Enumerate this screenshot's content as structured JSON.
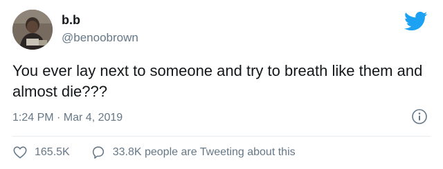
{
  "user": {
    "display_name": "b.b",
    "handle": "@benoobrown"
  },
  "tweet": {
    "text": "You ever lay next to someone and try to breath like them and almost die???",
    "timestamp": "1:24 PM · Mar 4, 2019"
  },
  "stats": {
    "likes": "165.5K",
    "retweet_discussion": "33.8K people are Tweeting about this"
  },
  "icons": {
    "brand": "twitter-bird-icon",
    "info": "info-icon",
    "like": "heart-icon",
    "reply": "speech-bubble-icon"
  },
  "colors": {
    "brand": "#1da1f2",
    "text": "#14171a",
    "secondary": "#657786",
    "divider": "#e6ecf0"
  }
}
